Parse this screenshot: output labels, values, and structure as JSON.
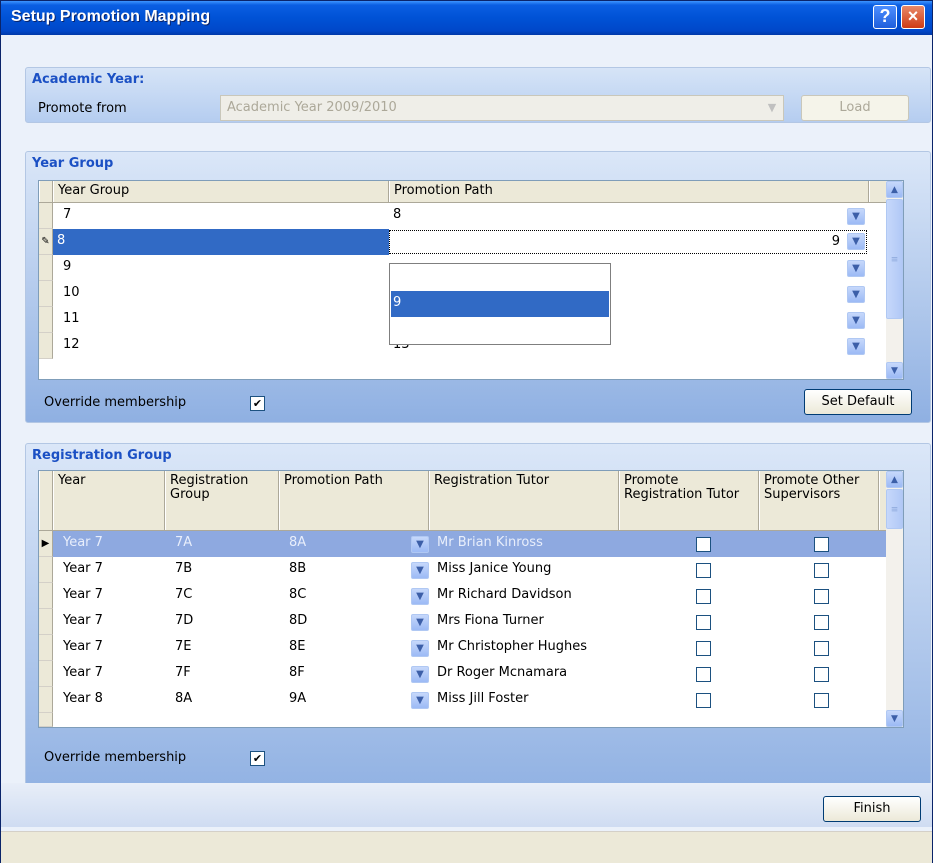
{
  "window": {
    "title": "Setup Promotion Mapping",
    "help_label": "?",
    "close_label": "×"
  },
  "academic_year": {
    "section_title": "Academic Year:",
    "promote_from_label": "Promote from",
    "selected": "Academic Year 2009/2010",
    "load_label": "Load"
  },
  "year_group": {
    "section_title": "Year Group",
    "columns": [
      "Year Group",
      "Promotion Path"
    ],
    "rows": [
      {
        "year": "7",
        "path": "8"
      },
      {
        "year": "8",
        "path": "9"
      },
      {
        "year": "9",
        "path": ""
      },
      {
        "year": "10",
        "path": ""
      },
      {
        "year": "11",
        "path": ""
      },
      {
        "year": "12",
        "path": "13"
      }
    ],
    "dropdown_options": [
      "",
      "9",
      ""
    ],
    "dropdown_selected": "9",
    "override_label": "Override membership",
    "override_checked": true,
    "set_default_label": "Set Default"
  },
  "registration_group": {
    "section_title": "Registration Group",
    "columns": [
      "Year",
      "Registration Group",
      "Promotion Path",
      "Registration Tutor",
      "Promote Registration Tutor",
      "Promote Other Supervisors"
    ],
    "rows": [
      {
        "year": "Year 7",
        "group": "7A",
        "path": "8A",
        "tutor": "Mr Brian Kinross"
      },
      {
        "year": "Year 7",
        "group": "7B",
        "path": "8B",
        "tutor": "Miss Janice Young"
      },
      {
        "year": "Year 7",
        "group": "7C",
        "path": "8C",
        "tutor": "Mr Richard Davidson"
      },
      {
        "year": "Year 7",
        "group": "7D",
        "path": "8D",
        "tutor": "Mrs Fiona Turner"
      },
      {
        "year": "Year 7",
        "group": "7E",
        "path": "8E",
        "tutor": "Mr Christopher Hughes"
      },
      {
        "year": "Year 7",
        "group": "7F",
        "path": "8F",
        "tutor": "Dr Roger Mcnamara"
      },
      {
        "year": "Year 8",
        "group": "8A",
        "path": "9A",
        "tutor": "Miss Jill Foster"
      }
    ],
    "override_label": "Override membership",
    "override_checked": true
  },
  "footer": {
    "finish_label": "Finish"
  },
  "colors": {
    "title_bar": "#0052d6",
    "selection": "#316ac5",
    "section_title": "#1b50c4"
  }
}
